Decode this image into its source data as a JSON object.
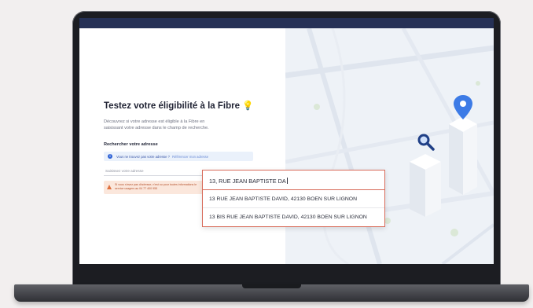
{
  "page": {
    "title": "Testez votre éligibilité à la Fibre",
    "description": "Découvrez si votre adresse est éligible à la Fibre en saisissant votre adresse dans le champ de recherche.",
    "search_label": "Rechercher votre adresse"
  },
  "info": {
    "question": "Vous ne trouvez pas votre adresse ?",
    "link": "Référencer mon adresse"
  },
  "search": {
    "placeholder": "Saisissez votre adresse"
  },
  "warning": {
    "text": "Si vous n'avez pas d'adresse, n'est ou pour toutes informations le service usagers au 04 77 400 955"
  },
  "autocomplete": {
    "query": "13, RUE JEAN BAPTISTE DA",
    "suggestions": [
      "13 RUE JEAN BAPTISTE DAVID, 42130 BOEN SUR LIGNON",
      "13 BIS RUE JEAN BAPTISTE DAVID, 42130 BOEN SUR LIGNON"
    ]
  },
  "colors": {
    "topbar": "#263156",
    "accent_blue": "#2f63d6",
    "dropdown_border": "#d86b5a",
    "warning_bg": "#fbe7dc",
    "map_pin": "#3d7be6",
    "search_marker": "#1f3f86"
  },
  "icons": {
    "bulb": "lightbulb-icon",
    "info": "info-icon",
    "warning": "warning-icon",
    "cursor": "hand-cursor-icon",
    "pin": "map-pin-icon",
    "magnifier": "magnifier-icon"
  }
}
